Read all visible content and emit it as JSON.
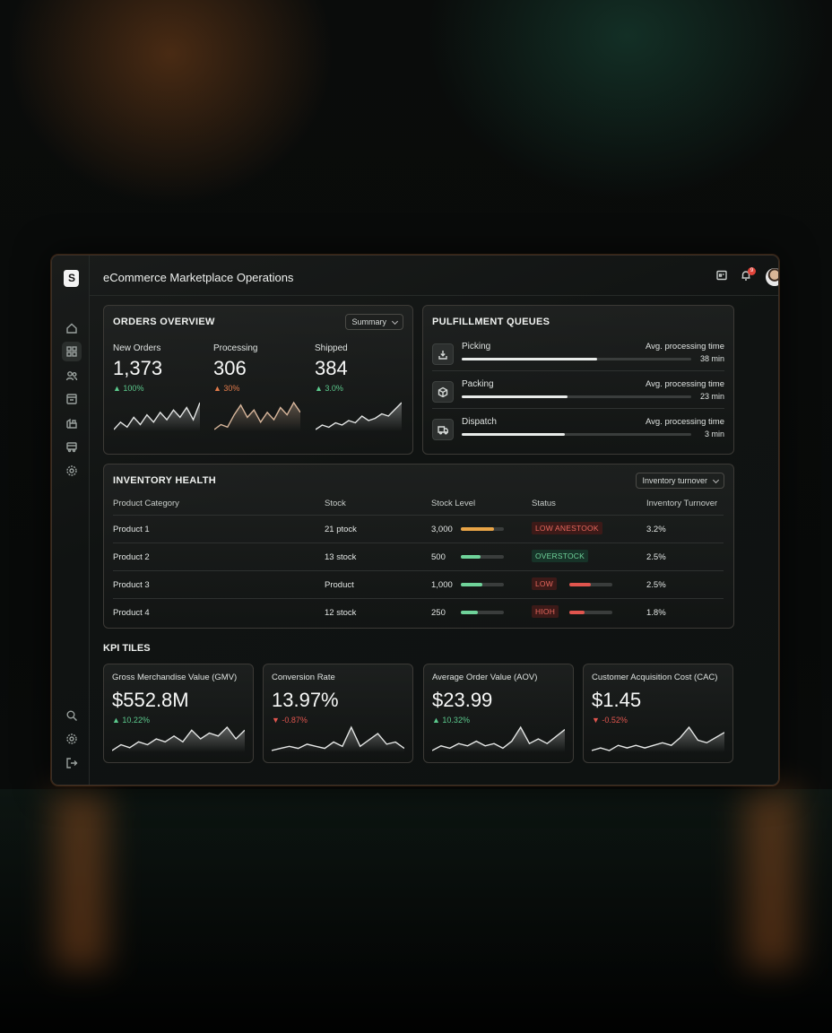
{
  "app": {
    "title": "eCommerce Marketplace Operations",
    "notification_count": "9"
  },
  "orders_overview": {
    "title": "ORDERS OVERVIEW",
    "dropdown": "Summary",
    "metrics": [
      {
        "label": "New Orders",
        "value": "1,373",
        "delta": "100%",
        "trend": "up",
        "spark": [
          3,
          6,
          4,
          8,
          5,
          9,
          6,
          10,
          7,
          11,
          8,
          12,
          7,
          14
        ]
      },
      {
        "label": "Processing",
        "value": "306",
        "delta": "30%",
        "trend": "up",
        "spark": [
          3,
          5,
          4,
          9,
          13,
          8,
          11,
          6,
          10,
          7,
          12,
          9,
          14,
          10
        ]
      },
      {
        "label": "Shipped",
        "value": "384",
        "delta": "3.0%",
        "trend": "up",
        "spark": [
          2,
          4,
          3,
          5,
          4,
          6,
          5,
          8,
          6,
          7,
          9,
          8,
          11,
          14
        ]
      }
    ]
  },
  "fulfillment": {
    "title": "PULFILLMENT QUEUES",
    "queues": [
      {
        "name": "Picking",
        "meta": "Avg. processing time",
        "time": "38 min",
        "progress": 0.59,
        "icon": "inbox-download-icon"
      },
      {
        "name": "Packing",
        "meta": "Avg. processing time",
        "time": "23 min",
        "progress": 0.46,
        "icon": "box-icon"
      },
      {
        "name": "Dispatch",
        "meta": "Avg. processing time",
        "time": "3 min",
        "progress": 0.45,
        "icon": "truck-icon"
      }
    ]
  },
  "inventory": {
    "title": "INVENTORY HEALTH",
    "dropdown": "Inventory turnover",
    "headers": [
      "Product Category",
      "Stock",
      "Stock Level",
      "Status",
      "Inventory Turnover"
    ],
    "rows": [
      {
        "category": "Product 1",
        "stock": "21 ptock",
        "level": "3,000",
        "level_fill": 0.78,
        "level_color": "#e8a447",
        "status": "LOW ANESTOOK",
        "status_type": "red",
        "status_bar": null,
        "turnover": "3.2%"
      },
      {
        "category": "Product 2",
        "stock": "13 stock",
        "level": "500",
        "level_fill": 0.45,
        "level_color": "#6fd39a",
        "status": "OVERSTOCK",
        "status_type": "green",
        "status_bar": null,
        "turnover": "2.5%"
      },
      {
        "category": "Product 3",
        "stock": "Product",
        "level": "1,000",
        "level_fill": 0.5,
        "level_color": "#6fd39a",
        "status": "LOW",
        "status_type": "red",
        "status_bar": 0.5,
        "turnover": "2.5%"
      },
      {
        "category": "Product 4",
        "stock": "12 stock",
        "level": "250",
        "level_fill": 0.4,
        "level_color": "#6fd39a",
        "status": "HIOH",
        "status_type": "red",
        "status_bar": 0.35,
        "turnover": "1.8%"
      }
    ]
  },
  "kpi": {
    "title": "KPI TILES",
    "tiles": [
      {
        "label": "Gross Merchandise Value (GMV)",
        "value": "$552.8M",
        "delta": "10.22%",
        "trend": "up",
        "spark": [
          4,
          6,
          5,
          7,
          6,
          8,
          7,
          9,
          7,
          11,
          8,
          10,
          9,
          12,
          8,
          11
        ]
      },
      {
        "label": "Conversion Rate",
        "value": "13.97%",
        "delta": "-0.87%",
        "trend": "down",
        "spark": [
          3,
          4,
          5,
          4,
          6,
          5,
          4,
          7,
          5,
          14,
          5,
          8,
          11,
          6,
          7,
          4
        ]
      },
      {
        "label": "Average Order Value (AOV)",
        "value": "$23.99",
        "delta": "10.32%",
        "trend": "up",
        "spark": [
          3,
          5,
          4,
          6,
          5,
          7,
          5,
          6,
          4,
          7,
          13,
          6,
          8,
          6,
          9,
          12
        ]
      },
      {
        "label": "Customer Acquisition Cost (CAC)",
        "value": "$1.45",
        "delta": "-0.52%",
        "trend": "down",
        "spark": [
          4,
          5,
          4,
          6,
          5,
          6,
          5,
          6,
          7,
          6,
          9,
          13,
          8,
          7,
          9,
          11
        ]
      }
    ]
  },
  "colors": {
    "up": "#5bc98c",
    "up_warm": "#e07a4a",
    "down": "#e0554e",
    "bar": "#e8ebe9"
  }
}
